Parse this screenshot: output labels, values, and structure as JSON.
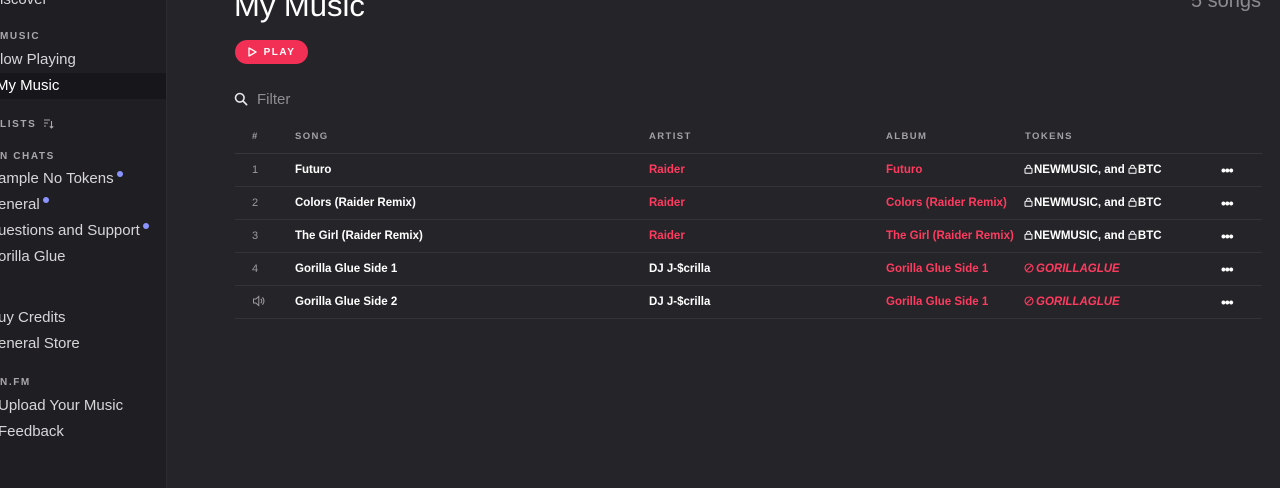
{
  "sidebar": {
    "discover": "iscover",
    "music_header": "MUSIC",
    "now_playing": "low Playing",
    "my_music": "My Music",
    "playlists_header": "LISTS",
    "chats_header": "N CHATS",
    "chats": [
      {
        "label": "ample No Tokens",
        "unread": true
      },
      {
        "label": "eneral",
        "unread": true
      },
      {
        "label": "uestions and Support",
        "unread": true
      },
      {
        "label": "orilla Glue",
        "unread": false
      }
    ],
    "buy_credits": "uy Credits",
    "general_store": "eneral Store",
    "fm_header": "N.FM",
    "upload": "Upload Your Music",
    "feedback": "Feedback"
  },
  "header": {
    "title": "My Music",
    "song_count": "5 songs",
    "play_label": "PLAY"
  },
  "filter": {
    "placeholder": "Filter"
  },
  "table": {
    "columns": {
      "num": "#",
      "song": "SONG",
      "artist": "ARTIST",
      "album": "ALBUM",
      "tokens": "TOKENS"
    },
    "rows": [
      {
        "num": "1",
        "song": "Futuro",
        "artist": "Raider",
        "album": "Futuro",
        "token_a": "NEWMUSIC, and ",
        "token_b": "BTC"
      },
      {
        "num": "2",
        "song": "Colors (Raider Remix)",
        "artist": "Raider",
        "album": "Colors (Raider Remix)",
        "token_a": "NEWMUSIC, and ",
        "token_b": "BTC"
      },
      {
        "num": "3",
        "song": "The Girl (Raider Remix)",
        "artist": "Raider",
        "album": "The Girl (Raider Remix)",
        "token_a": "NEWMUSIC, and ",
        "token_b": "BTC"
      },
      {
        "num": "4",
        "song": "Gorilla Glue Side 1",
        "artist": "DJ J-$crilla",
        "album": "Gorilla Glue Side 1",
        "token": "GORILLAGLUE"
      },
      {
        "num": "",
        "song": "Gorilla Glue Side 2",
        "artist": "DJ J-$crilla",
        "album": "Gorilla Glue Side 1",
        "token": "GORILLAGLUE",
        "playing": true
      }
    ],
    "more_label": "•••"
  },
  "colors": {
    "accent": "#f22f55",
    "link": "#ff3b5f",
    "dot": "#8a93ff"
  }
}
